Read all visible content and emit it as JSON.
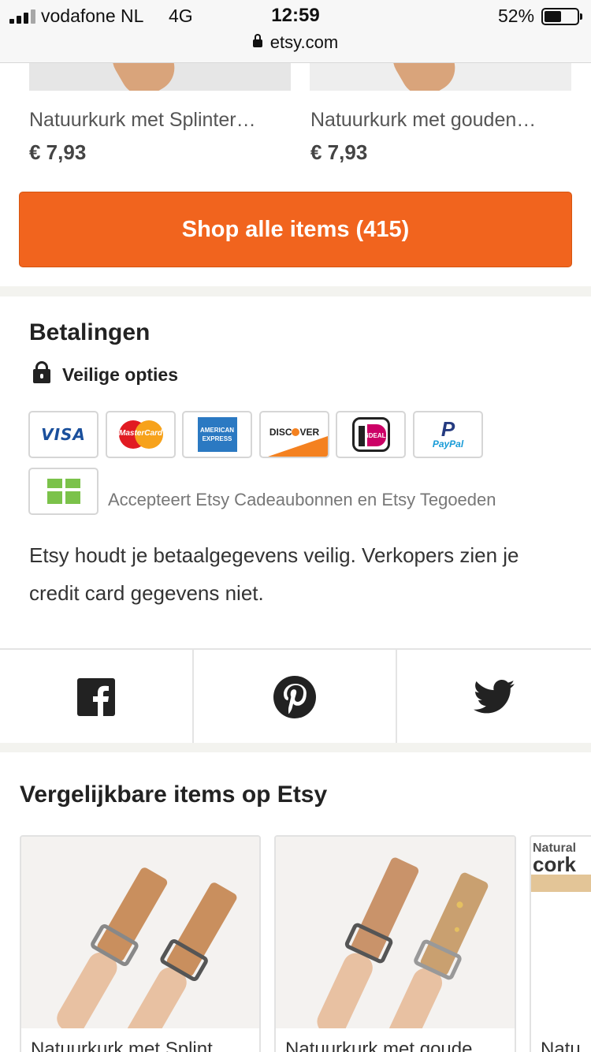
{
  "status_bar": {
    "carrier": "vodafone NL",
    "network": "4G",
    "time": "12:59",
    "battery_percent": "52%",
    "battery_level": 0.52,
    "url": "etsy.com"
  },
  "top_products": [
    {
      "title": "Natuurkurk met Splinter…",
      "price": "€ 7,93"
    },
    {
      "title": "Natuurkurk met gouden…",
      "price": "€ 7,93"
    }
  ],
  "shop_button": {
    "label": "Shop alle items (415)"
  },
  "payments": {
    "title": "Betalingen",
    "secure_label": "Veilige opties",
    "cards": {
      "visa": "VISA",
      "mastercard": "MasterCard",
      "amex_line1": "AMERICAN",
      "amex_line2": "EXPRESS",
      "discover": "DISC",
      "discover_end": "VER",
      "ideal": "iDEAL",
      "paypal_mark": "P",
      "paypal": "PayPal"
    },
    "gift_label": "Accepteert Etsy Cadeaubonnen en Etsy Tegoeden",
    "description": "Etsy houdt je betaalgegevens veilig. Verkopers zien je credit card gegevens niet."
  },
  "share": {
    "icons": [
      "facebook-icon",
      "pinterest-icon",
      "twitter-icon"
    ]
  },
  "similar": {
    "title": "Vergelijkbare items op Etsy",
    "items": [
      {
        "title": "Natuurkurk met Splint"
      },
      {
        "title": "Natuurkurk met goude"
      },
      {
        "title": "Natu",
        "image_text_1": "Natural",
        "image_text_2": "cork"
      }
    ]
  },
  "colors": {
    "accent": "#f1641e",
    "facebook": "#222222",
    "cork": "#d9a47b"
  }
}
